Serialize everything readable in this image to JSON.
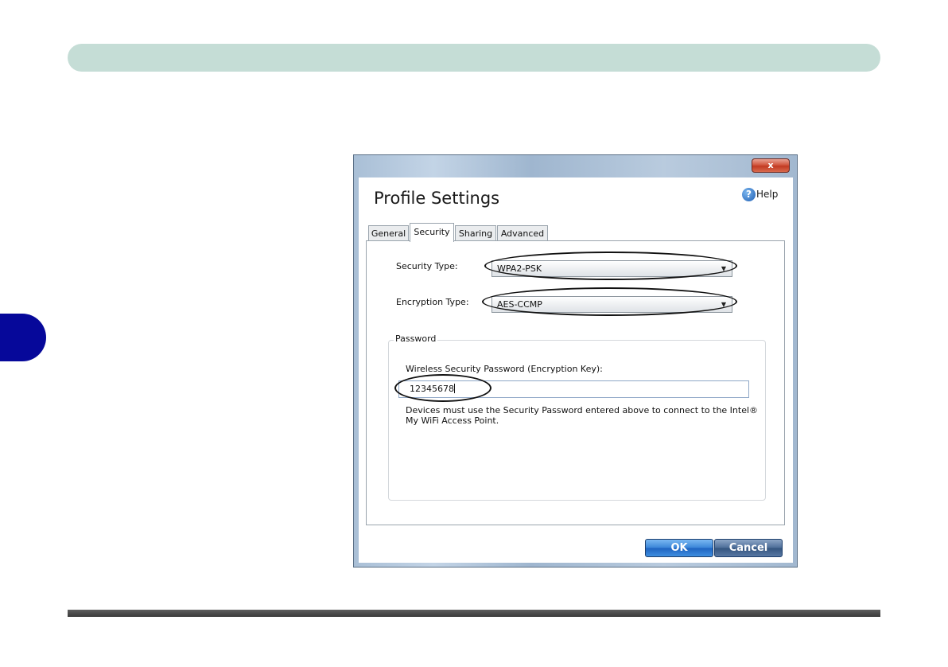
{
  "dialog": {
    "close_label": "x",
    "title": "Profile Settings",
    "help_label": "Help",
    "tabs": [
      {
        "label": "General"
      },
      {
        "label": "Security"
      },
      {
        "label": "Sharing"
      },
      {
        "label": "Advanced"
      }
    ],
    "active_tab": "Security",
    "security_type": {
      "label": "Security Type:",
      "value": "WPA2-PSK"
    },
    "encryption_type": {
      "label": "Encryption Type:",
      "value": "AES-CCMP"
    },
    "password_group": {
      "legend": "Password",
      "field_label": "Wireless Security Password (Encryption Key):",
      "value": "12345678",
      "note": "Devices must use the Security Password entered above to connect to the Intel® My WiFi Access Point."
    },
    "buttons": {
      "ok": "OK",
      "cancel": "Cancel"
    }
  },
  "icons": {
    "help": "help-icon",
    "dropdown": "chevron-down-icon"
  },
  "colors": {
    "header_bar": "#c5ddd6",
    "side_tab": "#06089a",
    "ok_button": "#3b86d8",
    "cancel_button": "#4f6f9a",
    "close_button": "#c23a22"
  }
}
